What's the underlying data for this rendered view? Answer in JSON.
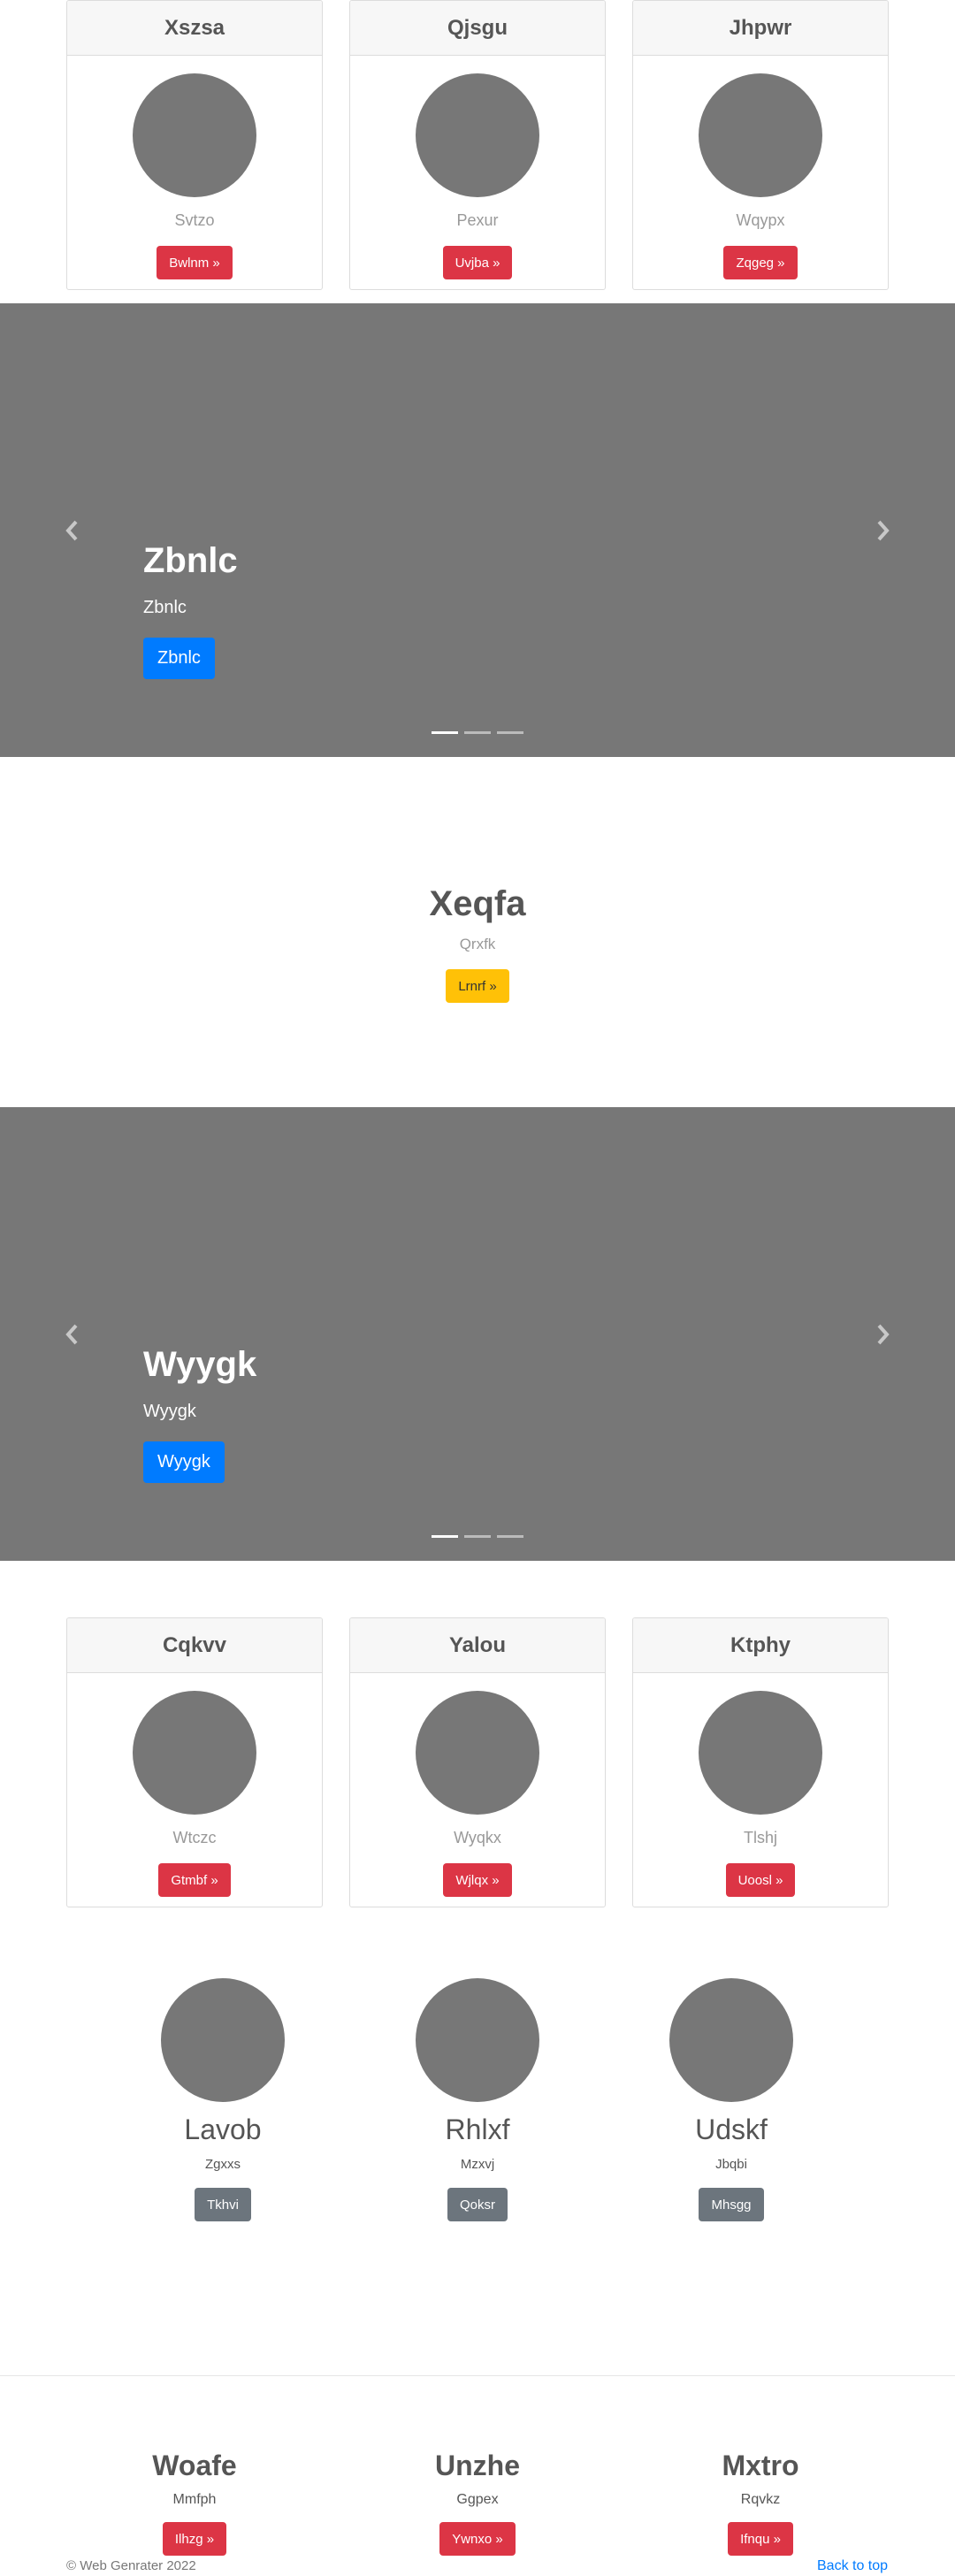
{
  "top_cards": [
    {
      "title": "Xszsa",
      "subtitle": "Svtzo",
      "button": "Bwlnm »"
    },
    {
      "title": "Qjsgu",
      "subtitle": "Pexur",
      "button": "Uvjba »"
    },
    {
      "title": "Jhpwr",
      "subtitle": "Wqypx",
      "button": "Zqgeg »"
    }
  ],
  "carousel_1": {
    "title": "Zbnlc",
    "text": "Zbnlc",
    "button": "Zbnlc",
    "slide_count": 3,
    "active_slide": 1
  },
  "hero": {
    "title": "Xeqfa",
    "subtitle": "Qrxfk",
    "button": "Lrnrf »"
  },
  "carousel_2": {
    "title": "Wyygk",
    "text": "Wyygk",
    "button": "Wyygk",
    "slide_count": 3,
    "active_slide": 1
  },
  "middle_cards": [
    {
      "title": "Cqkvv",
      "subtitle": "Wtczc",
      "button": "Gtmbf »"
    },
    {
      "title": "Yalou",
      "subtitle": "Wyqkx",
      "button": "Wjlqx »"
    },
    {
      "title": "Ktphy",
      "subtitle": "Tlshj",
      "button": "Uoosl »"
    }
  ],
  "features": [
    {
      "title": "Lavob",
      "subtitle": "Zgxxs",
      "button": "Tkhvi"
    },
    {
      "title": "Rhlxf",
      "subtitle": "Mzxvj",
      "button": "Qoksr"
    },
    {
      "title": "Udskf",
      "subtitle": "Jbqbi",
      "button": "Mhsgg"
    }
  ],
  "bottom_columns": [
    {
      "title": "Woafe",
      "subtitle": "Mmfph",
      "button": "Ilhzg »"
    },
    {
      "title": "Unzhe",
      "subtitle": "Ggpex",
      "button": "Ywnxo »"
    },
    {
      "title": "Mxtro",
      "subtitle": "Rqvkz",
      "button": "Ifnqu »"
    }
  ],
  "footer": {
    "copyright": "© Web Genrater 2022",
    "back_to_top": "Back to top"
  },
  "icons": {
    "carousel_prev": "chevron-left-icon",
    "carousel_next": "chevron-right-icon"
  },
  "colors": {
    "placeholder_gray": "#777777",
    "danger_red": "#dc3545",
    "primary_blue": "#007bff",
    "warning_yellow": "#ffc107",
    "secondary_gray": "#6c757d"
  }
}
